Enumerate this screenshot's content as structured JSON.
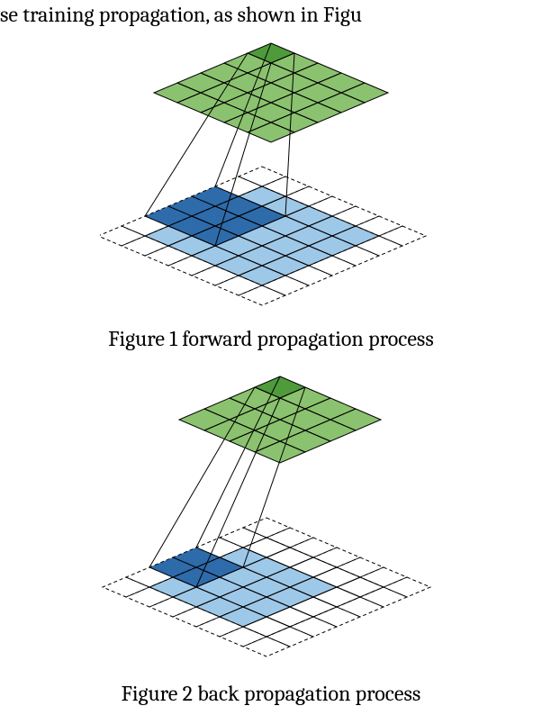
{
  "top_text_fragment": "se training propagation, as shown in Figu",
  "figure1": {
    "caption": "Figure 1 forward propagation process",
    "top_grid": {
      "rows": 5,
      "cols": 5,
      "highlight": [
        0,
        0
      ]
    },
    "bottom_grid": {
      "rows": 7,
      "cols": 7,
      "padding": 1,
      "kernel": {
        "row": 2,
        "col": 0,
        "h": 3,
        "w": 3
      },
      "valid": {
        "row": 1,
        "col": 1,
        "h": 5,
        "w": 5
      }
    }
  },
  "figure2": {
    "caption": "Figure 2 back propagation process",
    "top_grid": {
      "rows": 4,
      "cols": 4,
      "highlight": [
        0,
        0
      ]
    },
    "bottom_grid": {
      "rows": 7,
      "cols": 7,
      "padding": 1,
      "kernel": {
        "row": 3,
        "col": 0,
        "h": 2,
        "w": 2
      },
      "valid": {
        "row": 2,
        "col": 1,
        "h": 4,
        "w": 4
      }
    }
  },
  "colors": {
    "green": "#8bc26f",
    "green_dark": "#4f9b3b",
    "blue": "#9ec8e8",
    "blue_dark": "#2e6bab",
    "stroke": "#000000"
  }
}
